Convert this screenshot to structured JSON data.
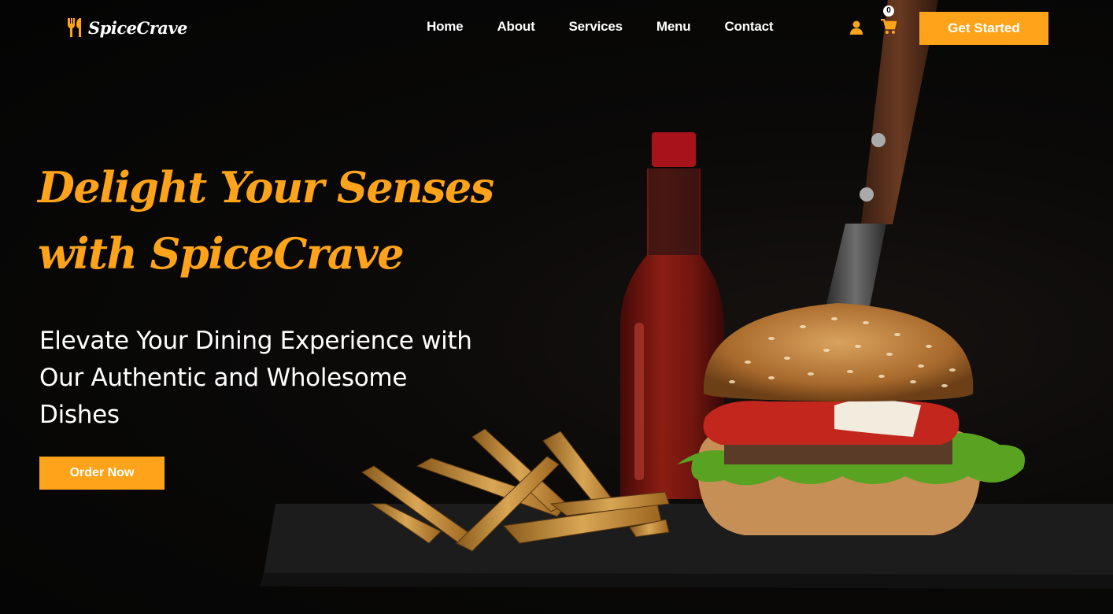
{
  "brand": {
    "name": "SpiceCrave",
    "accent": "#ffa31a"
  },
  "nav": {
    "items": [
      {
        "label": "Home"
      },
      {
        "label": "About"
      },
      {
        "label": "Services"
      },
      {
        "label": "Menu"
      },
      {
        "label": "Contact"
      }
    ]
  },
  "header": {
    "cart_count": "0",
    "cta_label": "Get Started",
    "icons": [
      "user-icon",
      "cart-icon"
    ]
  },
  "hero": {
    "title_line1": "Delight Your Senses",
    "title_line2": "with SpiceCrave",
    "subtitle_line1": "Elevate Your Dining Experience with",
    "subtitle_line2": "Our Authentic and Wholesome",
    "subtitle_line3": "Dishes",
    "order_label": "Order Now"
  }
}
